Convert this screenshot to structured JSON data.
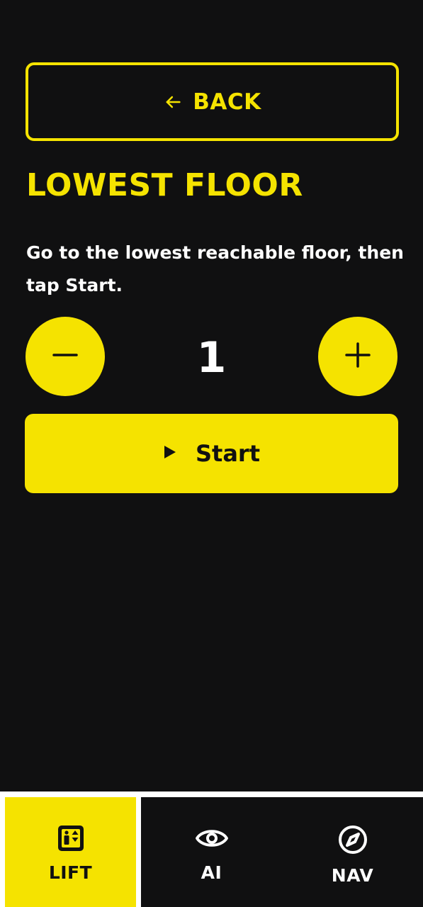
{
  "back_button": {
    "label": "BACK",
    "icon": "arrow-left-icon"
  },
  "page": {
    "title": "LOWEST FLOOR",
    "instructions": "Go to the lowest reachable floor, then tap Start."
  },
  "stepper": {
    "value": "1",
    "decrement_icon": "minus-icon",
    "increment_icon": "plus-icon"
  },
  "start_button": {
    "label": "Start",
    "icon": "play-icon"
  },
  "tabbar": {
    "tabs": [
      {
        "label": "LIFT",
        "icon": "elevator-icon",
        "active": true
      },
      {
        "label": "AI",
        "icon": "eye-icon",
        "active": false
      },
      {
        "label": "NAV",
        "icon": "compass-icon",
        "active": false
      }
    ]
  },
  "colors": {
    "accent": "#f5e300",
    "background": "#101011",
    "text": "#ffffff"
  }
}
